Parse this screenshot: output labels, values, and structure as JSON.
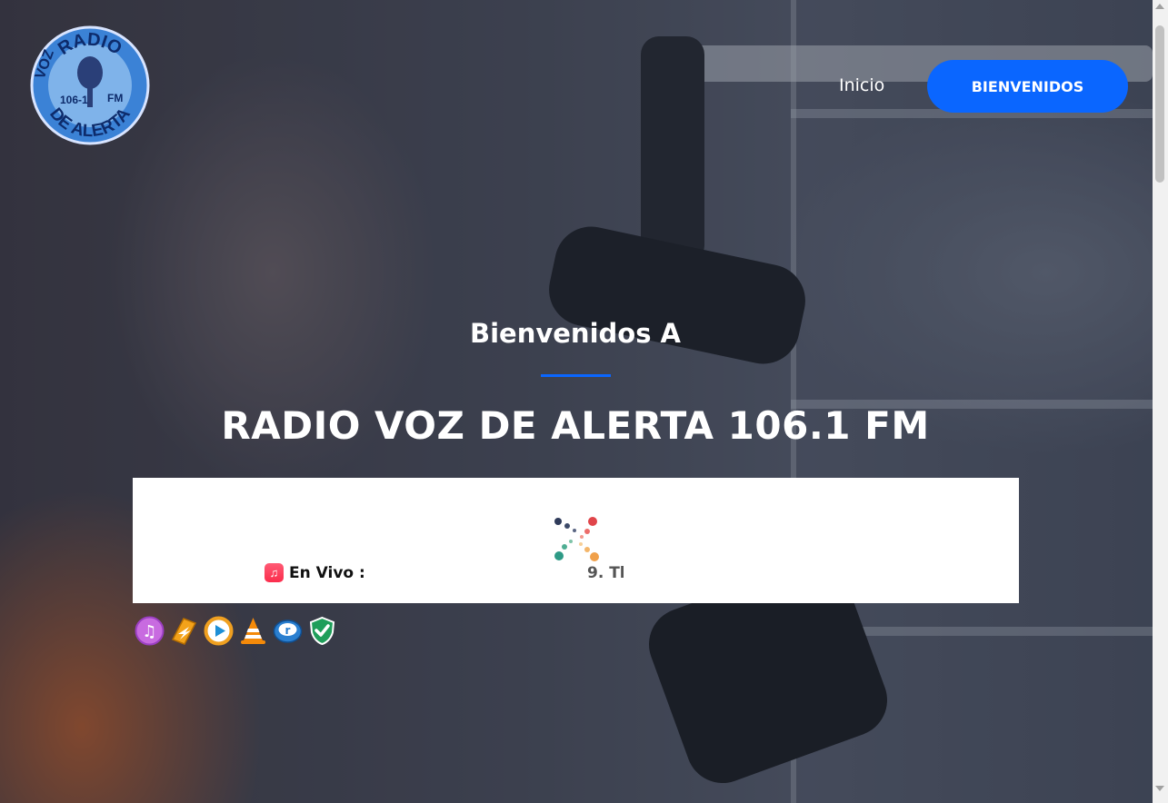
{
  "brand": {
    "logo_top_text": "RADIO",
    "logo_side_text": "VOZ",
    "logo_frequency": "106-1",
    "logo_band": "FM",
    "logo_bottom_text": "DE ALERTA"
  },
  "nav": {
    "home_label": "Inicio",
    "welcome_button_label": "BIENVENIDOS"
  },
  "hero": {
    "subtitle": "Bienvenidos A",
    "title": "RADIO VOZ DE ALERTA 106.1 FM"
  },
  "player": {
    "live_label": "En Vivo :",
    "now_playing": "9. Tl"
  },
  "app_icons": [
    "itunes-icon",
    "winamp-icon",
    "windows-media-player-icon",
    "vlc-icon",
    "realplayer-icon",
    "security-shield-icon"
  ],
  "colors": {
    "accent": "#0a66ff",
    "player_background": "#ffffff"
  }
}
